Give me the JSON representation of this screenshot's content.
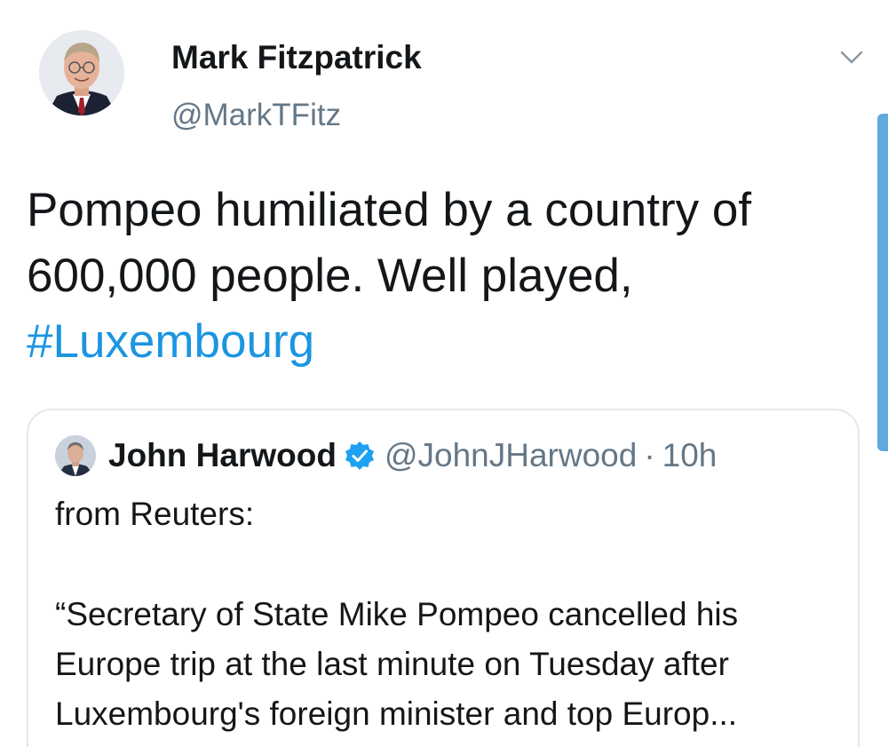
{
  "tweet": {
    "author": {
      "name": "Mark Fitzpatrick",
      "handle": "@MarkTFitz"
    },
    "text_main": "Pompeo humiliated by a country of 600,000 people.  Well played, ",
    "hashtag": "#Luxembourg",
    "menu_icon": "chevron-down-icon"
  },
  "quote": {
    "author": {
      "name": "John Harwood",
      "handle": "@JohnJHarwood",
      "separator": "·",
      "time": "10h",
      "verified_icon": "verified-badge-icon"
    },
    "line1": "from Reuters:",
    "body": "“Secretary of State Mike Pompeo cancelled his Europe trip at the last minute on Tuesday after Luxembourg's foreign minister and top Europ..."
  },
  "colors": {
    "text": "#14171a",
    "secondary": "#657786",
    "link": "#1b95e0",
    "border": "#e1e8ed",
    "verified": "#1da1f2"
  }
}
